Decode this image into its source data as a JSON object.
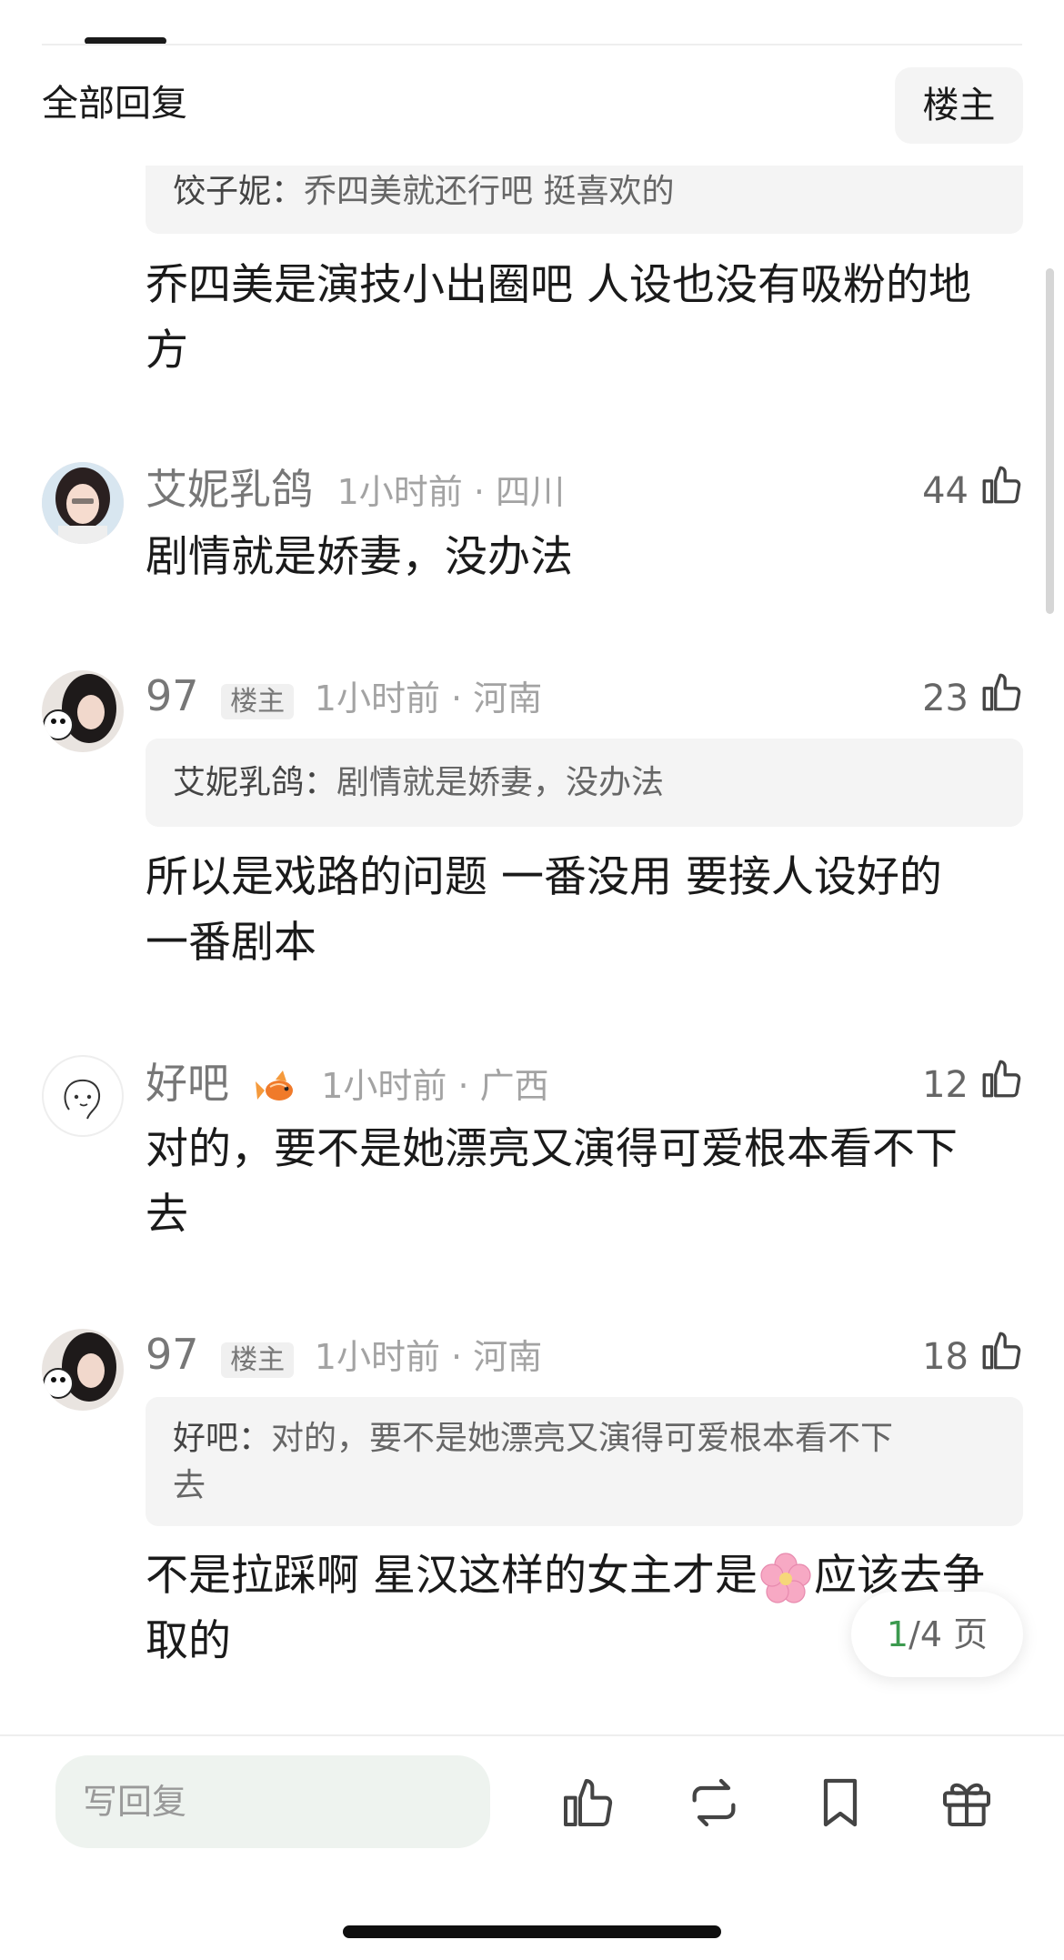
{
  "header": {
    "section_title": "全部回复",
    "owner_filter": "楼主"
  },
  "top_comment": {
    "quote_name": "饺子妮：",
    "quote_text": "乔四美就还行吧 挺喜欢的",
    "body_line1": "乔四美是演技小出圈吧  人设也没有吸粉的地",
    "body_line2": "方"
  },
  "comments": [
    {
      "name": "艾妮乳鸽",
      "meta": "1小时前 · 四川",
      "likes": "44",
      "body_line1": "剧情就是娇妻，没办法"
    },
    {
      "name": "97",
      "badge": "楼主",
      "meta": "1小时前 · 河南",
      "likes": "23",
      "quote_name": "艾妮乳鸽：",
      "quote_text": "剧情就是娇妻，没办法",
      "body_line1": "所以是戏路的问题  一番没用 要接人设好的",
      "body_line2": "一番剧本"
    },
    {
      "name": "好吧",
      "meta": "1小时前 · 广西",
      "likes": "12",
      "body_line1": "对的，要不是她漂亮又演得可爱根本看不下",
      "body_line2": "去"
    },
    {
      "name": "97",
      "badge": "楼主",
      "meta": "1小时前 · 河南",
      "likes": "18",
      "quote_name": "好吧：",
      "quote_text_line1": "对的，要不是她漂亮又演得可爱根本看不下",
      "quote_text_line2": "去",
      "body_line1_a": "不是拉踩啊 星汉这样的女主才是",
      "body_line1_b": "应该去争",
      "body_line2": "取的"
    }
  ],
  "pagination": {
    "current": "1",
    "total": "/4 页"
  },
  "footer": {
    "reply_placeholder": "写回复"
  },
  "colors": {
    "accent_green": "#3c9a4f",
    "muted": "#a3a3a3",
    "quote_bg": "#f4f4f4"
  },
  "icons": [
    "thumbs-up-icon",
    "repost-icon",
    "bookmark-icon",
    "gift-icon",
    "fish-emoji-icon",
    "cherry-blossom-emoji-icon"
  ]
}
